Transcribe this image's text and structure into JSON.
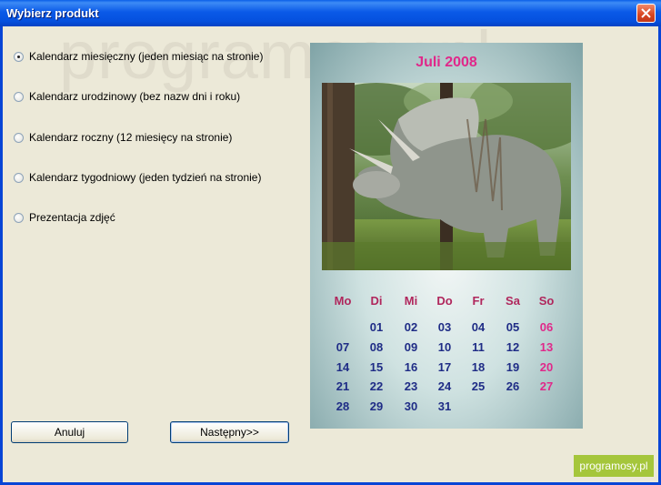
{
  "window": {
    "title": "Wybierz produkt"
  },
  "watermark": "programosy.pl",
  "options": [
    {
      "label": "Kalendarz miesięczny (jeden miesiąc na stronie)",
      "checked": true
    },
    {
      "label": "Kalendarz urodzinowy (bez nazw dni i roku)",
      "checked": false
    },
    {
      "label": "Kalendarz roczny (12 miesięcy na stronie)",
      "checked": false
    },
    {
      "label": "Kalendarz tygodniowy (jeden tydzień na stronie)",
      "checked": false
    },
    {
      "label": "Prezentacja zdjęć",
      "checked": false
    }
  ],
  "preview": {
    "title": "Juli 2008",
    "weekdays": [
      "Mo",
      "Di",
      "Mi",
      "Do",
      "Fr",
      "Sa",
      "So"
    ],
    "weeks": [
      [
        "",
        "01",
        "02",
        "03",
        "04",
        "05",
        "06"
      ],
      [
        "07",
        "08",
        "09",
        "10",
        "11",
        "12",
        "13"
      ],
      [
        "14",
        "15",
        "16",
        "17",
        "18",
        "19",
        "20"
      ],
      [
        "21",
        "22",
        "23",
        "24",
        "25",
        "26",
        "27"
      ],
      [
        "28",
        "29",
        "30",
        "31",
        "",
        "",
        ""
      ]
    ],
    "colors": {
      "title": "#e0288a",
      "weekday": "#b0265c",
      "day": "#1f2c86",
      "sunday": "#e0288a"
    }
  },
  "buttons": {
    "cancel": "Anuluj",
    "next": "Następny>>"
  },
  "badge": "programosy.pl"
}
